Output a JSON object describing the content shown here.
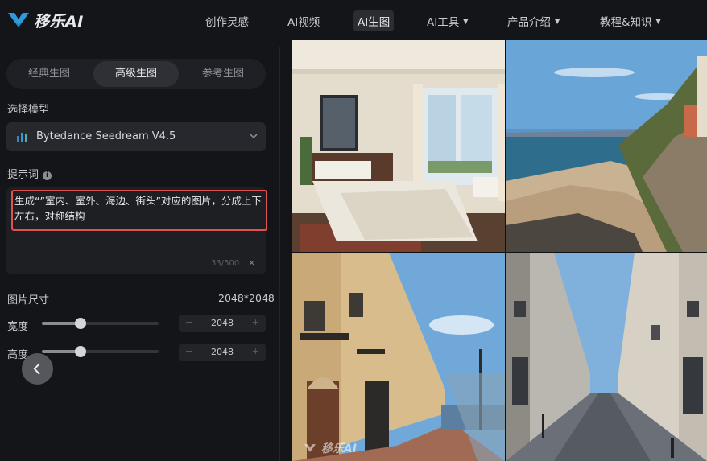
{
  "app": {
    "logo_text": "移乐AI"
  },
  "nav": {
    "items": [
      {
        "label": "创作灵感"
      },
      {
        "label": "AI视频"
      },
      {
        "label": "AI生图"
      },
      {
        "label": "AI工具"
      },
      {
        "label": "产品介绍"
      },
      {
        "label": "教程&知识"
      }
    ],
    "active": "AI生图",
    "dropdown_caret": "▼"
  },
  "mode_tabs": [
    {
      "label": "经典生图"
    },
    {
      "label": "高级生图"
    },
    {
      "label": "参考生图"
    }
  ],
  "active_mode": "高级生图",
  "model": {
    "label": "选择模型",
    "selected": "Bytedance Seedream V4.5",
    "icon": "bar-chart-icon"
  },
  "prompt": {
    "label": "提示词",
    "info_icon": "i",
    "text": "生成“”室内、室外、海边、街头”对应的图片，分成上下左右，对称结构",
    "char_count": "33/500",
    "clear_symbol": "×"
  },
  "size": {
    "label": "图片尺寸",
    "value": "2048*2048",
    "width_label": "宽度",
    "width_value": "2048",
    "height_label": "高度",
    "height_value": "2048",
    "minus": "−",
    "plus": "+"
  },
  "images": [
    {
      "name": "bedroom-interior"
    },
    {
      "name": "beach-coast"
    },
    {
      "name": "street-balconies"
    },
    {
      "name": "street-perspective"
    }
  ],
  "watermark": "移乐AI",
  "colors": {
    "accent_blue": "#2f9bd6",
    "highlight_red": "#e25050",
    "background": "#141518"
  }
}
